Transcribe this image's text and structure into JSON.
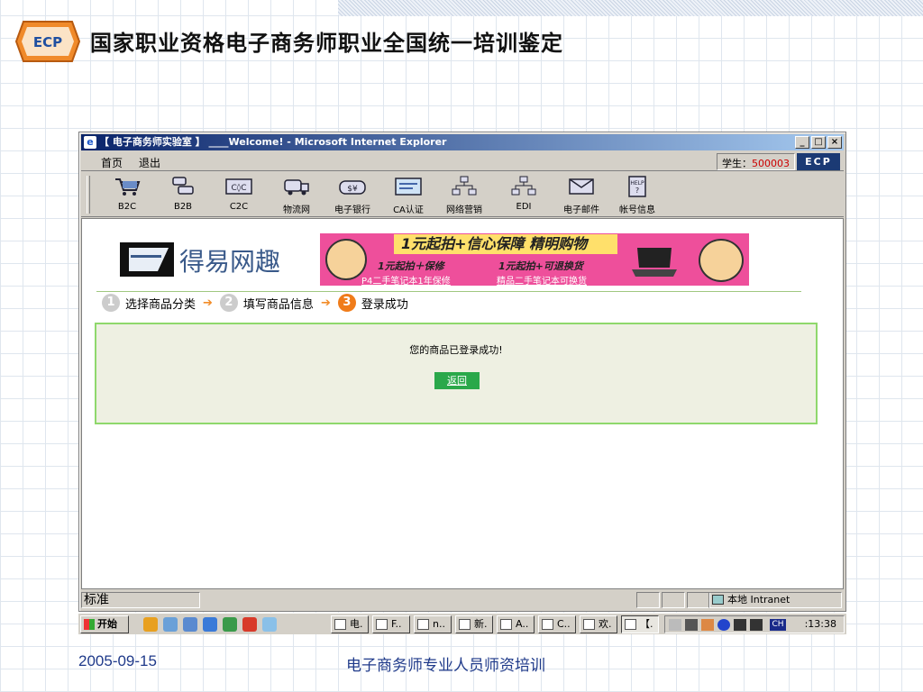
{
  "slide": {
    "title": "国家职业资格电子商务师职业全国统一培训鉴定",
    "logo_text": "ECP",
    "footer_date": "2005-09-15",
    "footer_text": "电子商务师专业人员师资培训"
  },
  "window": {
    "title": "【 电子商务师实验室 】 ____Welcome! - Microsoft Internet Explorer",
    "controls": [
      "_",
      "□",
      "×"
    ],
    "menu": [
      "首页",
      "退出"
    ],
    "student_label": "学生：",
    "student_id": "500003",
    "badge": "ECP"
  },
  "toolbar": {
    "items": [
      {
        "label": "B2C",
        "icon": "cart-icon"
      },
      {
        "label": "B2B",
        "icon": "servers-icon"
      },
      {
        "label": "C2C",
        "icon": "c2c-icon"
      },
      {
        "label": "物流网",
        "icon": "truck-icon"
      },
      {
        "label": "电子银行",
        "icon": "money-icon"
      },
      {
        "label": "CA认证",
        "icon": "certificate-icon"
      },
      {
        "label": "网络营销",
        "icon": "network-icon"
      },
      {
        "label": "EDI",
        "icon": "edi-icon"
      },
      {
        "label": "电子邮件",
        "icon": "email-icon"
      },
      {
        "label": "帐号信息",
        "icon": "help-icon"
      }
    ]
  },
  "page": {
    "brand": "得易网趣",
    "banner": {
      "headline": "1元起拍+信心保障 精明购物",
      "line1": "1元起拍＋保修",
      "line2": "1元起拍+可退换货",
      "link1": "P4二手笔记本1年保修",
      "link2": "精品二手笔记本可换货"
    },
    "steps": [
      {
        "num": "1",
        "label": "选择商品分类"
      },
      {
        "num": "2",
        "label": "填写商品信息"
      },
      {
        "num": "3",
        "label": "登录成功"
      }
    ],
    "message": "您的商品已登录成功!",
    "back_button": "返回"
  },
  "statusbar": {
    "left": "标准",
    "zone": "本地 Intranet"
  },
  "taskbar": {
    "start": "开始",
    "tasks": [
      "电.",
      "F..",
      "n..",
      "新.",
      "A..",
      "C..",
      "欢.",
      "【."
    ],
    "lang": "CH",
    "clock": ":13:38"
  },
  "colors": {
    "titlebar_start": "#0a246a",
    "titlebar_end": "#a6caf0",
    "banner_pink": "#ee4f9b",
    "step_active": "#f07c1a",
    "msg_border": "#8fd86c",
    "back_button": "#2aa84a",
    "student_id": "#cc0000"
  }
}
